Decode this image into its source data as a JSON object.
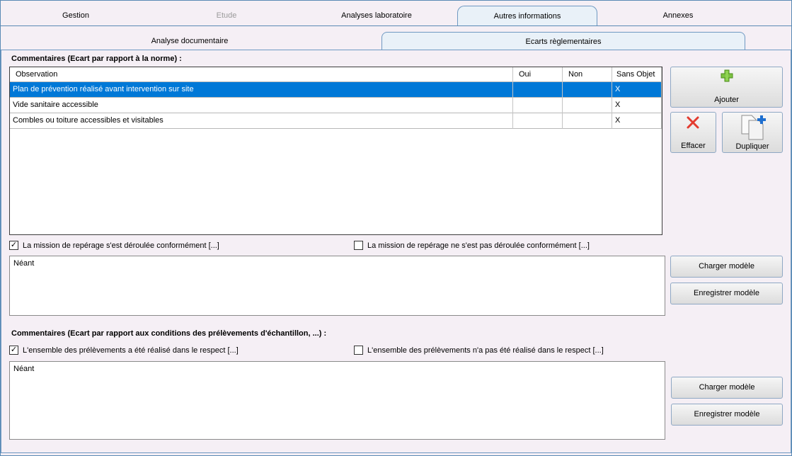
{
  "tabs_top": [
    {
      "label": "Gestion",
      "state": "normal"
    },
    {
      "label": "Etude",
      "state": "disabled"
    },
    {
      "label": "Analyses laboratoire",
      "state": "normal"
    },
    {
      "label": "Autres informations",
      "state": "active"
    },
    {
      "label": "Annexes",
      "state": "normal"
    }
  ],
  "tabs_sub": [
    {
      "label": "Analyse documentaire",
      "state": "normal"
    },
    {
      "label": "Ecarts règlementaires",
      "state": "active"
    }
  ],
  "section1": {
    "title": "Commentaires (Ecart par rapport à la norme) :",
    "columns": [
      "Observation",
      "Oui",
      "Non",
      "Sans Objet"
    ],
    "rows": [
      {
        "observation": "Plan de prévention réalisé avant intervention sur site",
        "oui": "",
        "non": "",
        "sans_objet": "X",
        "selected": true
      },
      {
        "observation": "Vide sanitaire accessible",
        "oui": "",
        "non": "",
        "sans_objet": "X",
        "selected": false
      },
      {
        "observation": "Combles ou toiture accessibles et visitables",
        "oui": "",
        "non": "",
        "sans_objet": "X",
        "selected": false
      }
    ],
    "check_ok": {
      "label": "La mission de repérage s'est déroulée conformément [...]",
      "checked": true
    },
    "check_nok": {
      "label": "La mission de repérage ne s'est pas déroulée conformément [...]",
      "checked": false
    },
    "comment": "Néant"
  },
  "section2": {
    "title": "Commentaires (Ecart par rapport aux conditions des prélèvements d'échantillon, ...) :",
    "check_ok": {
      "label": "L'ensemble des prélèvements a été réalisé dans le respect [...]",
      "checked": true
    },
    "check_nok": {
      "label": "L'ensemble des prélèvements n'a pas été réalisé dans le respect [...]",
      "checked": false
    },
    "comment": "Néant"
  },
  "buttons": {
    "add": "Ajouter",
    "delete": "Effacer",
    "duplicate": "Dupliquer",
    "load_model": "Charger modèle",
    "save_model": "Enregistrer modèle"
  },
  "check_mark": "✓",
  "colors": {
    "selection": "#0078d7",
    "tab_active": "#e9f1f8",
    "border": "#6f99c2"
  }
}
